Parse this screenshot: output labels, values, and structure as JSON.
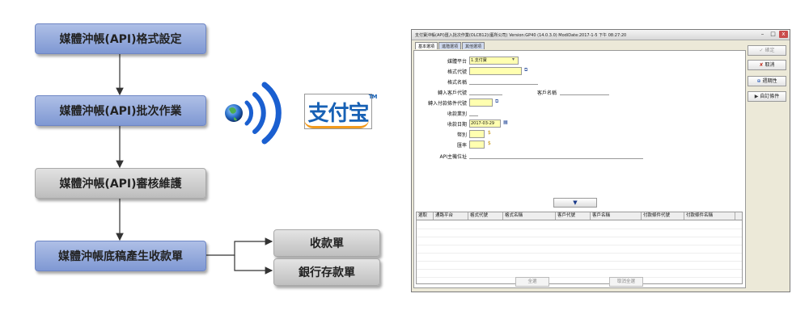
{
  "flowchart": {
    "steps": [
      {
        "label": "媒體沖帳(API)格式設定",
        "style": "blue"
      },
      {
        "label": "媒體沖帳(API)批次作業",
        "style": "blue"
      },
      {
        "label": "媒體沖帳(API)審核維護",
        "style": "gray"
      },
      {
        "label": "媒體沖帳底稿產生收款單",
        "style": "blue"
      }
    ],
    "outputs": [
      "收款單",
      "銀行存款單"
    ]
  },
  "logo": {
    "text": "支付宝",
    "tm": "TM"
  },
  "window": {
    "title": "支付寶沖帳(API)匯入批次作業(OLCB12)(藝所公司) Version:GP40 (14.0.3.0) ModiDate:2017-1-5 下午 08:27:20",
    "controls": {
      "minimize": "–",
      "maximize": "□",
      "close": "x"
    },
    "tabs": [
      "基本選項",
      "進階選項",
      "其他選項"
    ],
    "form": {
      "media_platform": {
        "label": "媒體平台",
        "value": "1.支付寶"
      },
      "format_code": {
        "label": "格式代號",
        "value": ""
      },
      "format_name": {
        "label": "格式名稱",
        "value": ""
      },
      "import_customer_code": {
        "label": "轉入客戶代號",
        "value": ""
      },
      "customer_name": {
        "label": "客戶名稱",
        "value": ""
      },
      "import_payment_terms": {
        "label": "轉入付款條件代號",
        "value": ""
      },
      "receipt_category": {
        "label": "收款業別",
        "value": ""
      },
      "receipt_date": {
        "label": "收款日期",
        "value": "2017-03-29"
      },
      "currency": {
        "label": "幣別",
        "value": ""
      },
      "exchange_rate": {
        "label": "匯率",
        "value": ""
      },
      "api_host": {
        "label": "API主機位址",
        "value": ""
      }
    },
    "grid": {
      "columns": [
        "選取",
        "通路平台",
        "格式代號",
        "格式名稱",
        "客戶代號",
        "客戶名稱",
        "付款條件代號",
        "付款條件名稱"
      ]
    },
    "bottom_buttons": {
      "select_all": "全選",
      "deselect_all": "取消全選"
    },
    "side_buttons": [
      {
        "icon": "✓",
        "label": "確定",
        "disabled": true
      },
      {
        "icon": "✘",
        "label": "取消",
        "disabled": false
      },
      {
        "icon": "⊕",
        "label": "週期性",
        "disabled": false
      },
      {
        "icon": "▶",
        "label": "自訂條件",
        "disabled": false
      }
    ],
    "expand_icon": "▼"
  },
  "colors": {
    "blue_box": "#8fa7dc",
    "gray_box": "#cfcfcf",
    "logo_blue": "#1761b5",
    "logo_orange": "#f29a1d",
    "highlight": "#ffffb0"
  }
}
